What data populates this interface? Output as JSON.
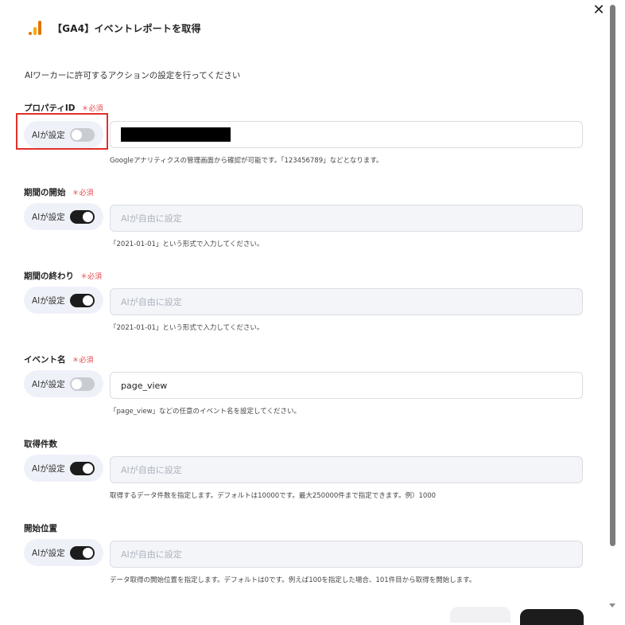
{
  "dialog": {
    "title": "【GA4】イベントレポートを取得",
    "close_icon": "close-icon",
    "description": "AIワーカーに許可するアクションの設定を行ってください"
  },
  "toggle_label": "AIが設定",
  "required_label": "＊必須",
  "fields": [
    {
      "label": "プロパティID",
      "required": true,
      "ai_enabled": false,
      "value_redacted": true,
      "placeholder": "",
      "hint": "Googleアナリティクスの管理画面から確認が可能です。「123456789」などとなります。"
    },
    {
      "label": "期間の開始",
      "required": true,
      "ai_enabled": true,
      "placeholder": "AIが自由に設定",
      "hint": "「2021-01-01」という形式で入力してください。"
    },
    {
      "label": "期間の終わり",
      "required": true,
      "ai_enabled": true,
      "placeholder": "AIが自由に設定",
      "hint": "「2021-01-01」という形式で入力してください。"
    },
    {
      "label": "イベント名",
      "required": true,
      "ai_enabled": false,
      "value": "page_view",
      "hint": "「page_view」などの任意のイベント名を設定してください。"
    },
    {
      "label": "取得件数",
      "required": false,
      "ai_enabled": true,
      "placeholder": "AIが自由に設定",
      "hint": "取得するデータ件数を指定します。デフォルトは10000です。最大250000件まで指定できます。例）1000"
    },
    {
      "label": "開始位置",
      "required": false,
      "ai_enabled": true,
      "placeholder": "AIが自由に設定",
      "hint": "データ取得の開始位置を指定します。デフォルトは0です。例えば100を指定した場合、101件目から取得を開始します。"
    }
  ],
  "colors": {
    "required": "#e5484d",
    "toggle_on": "#1c1c1c",
    "toggle_off": "#c9ccd3",
    "highlight": "#e0302b",
    "ga_orange": "#e37400",
    "ga_yellow": "#f9ab00"
  }
}
